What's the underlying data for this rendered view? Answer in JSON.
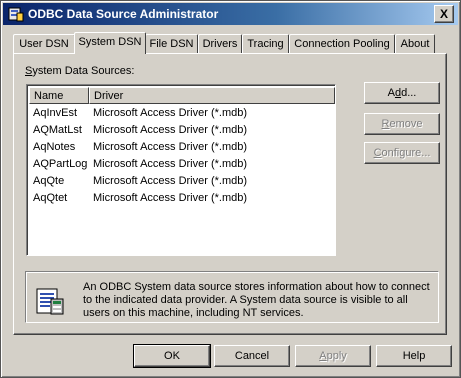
{
  "window": {
    "title": "ODBC Data Source Administrator",
    "close_label": "X"
  },
  "tabs": [
    {
      "label": "User DSN",
      "active": false
    },
    {
      "label": "System DSN",
      "active": true
    },
    {
      "label": "File DSN",
      "active": false
    },
    {
      "label": "Drivers",
      "active": false
    },
    {
      "label": "Tracing",
      "active": false
    },
    {
      "label": "Connection Pooling",
      "active": false
    },
    {
      "label": "About",
      "active": false
    }
  ],
  "system_dsn": {
    "list_label_prefix": "",
    "list_label_mnemonic": "S",
    "list_label_rest": "ystem Data Sources:",
    "columns": [
      "Name",
      "Driver"
    ],
    "rows": [
      {
        "name": "AqInvEst",
        "driver": "Microsoft Access Driver (*.mdb)"
      },
      {
        "name": "AQMatLst",
        "driver": "Microsoft Access Driver (*.mdb)"
      },
      {
        "name": "AqNotes",
        "driver": "Microsoft Access Driver (*.mdb)"
      },
      {
        "name": "AQPartLog",
        "driver": "Microsoft Access Driver (*.mdb)"
      },
      {
        "name": "AqQte",
        "driver": "Microsoft Access Driver (*.mdb)"
      },
      {
        "name": "AqQtet",
        "driver": "Microsoft Access Driver (*.mdb)"
      }
    ],
    "buttons": {
      "add": {
        "pre": "A",
        "mn": "d",
        "post": "d..."
      },
      "remove": {
        "pre": "",
        "mn": "R",
        "post": "emove"
      },
      "configure": {
        "pre": "",
        "mn": "C",
        "post": "onfigure..."
      }
    },
    "info_text": "An ODBC System data source stores information about how to connect to the indicated data provider.  A System data source is visible to all users on this machine, including NT services."
  },
  "footer": {
    "ok": "OK",
    "cancel": "Cancel",
    "apply_mn": "A",
    "apply_rest": "pply",
    "help": "Help"
  }
}
